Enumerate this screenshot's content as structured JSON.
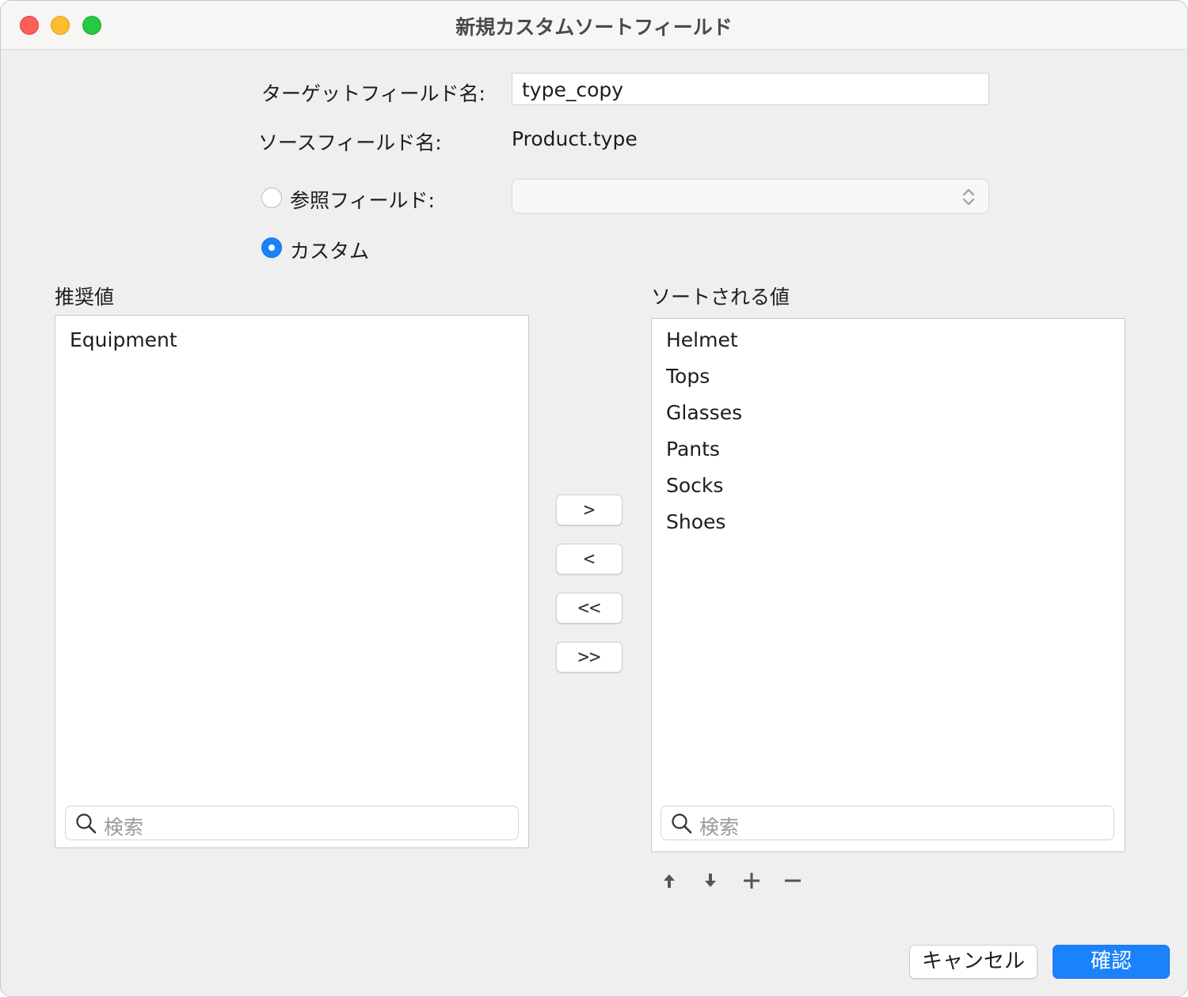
{
  "window": {
    "title": "新規カスタムソートフィールド"
  },
  "form": {
    "target_label": "ターゲットフィールド名:",
    "target_value": "type_copy",
    "source_label": "ソースフィールド名:",
    "source_value": "Product.type",
    "reference_label": "参照フィールド:",
    "reference_value": "",
    "custom_label": "カスタム",
    "selected_option": "custom"
  },
  "left_list": {
    "heading": "推奨値",
    "items": [
      "Equipment"
    ],
    "search_placeholder": "検索"
  },
  "right_list": {
    "heading": "ソートされる値",
    "items": [
      "Helmet",
      "Tops",
      "Glasses",
      "Pants",
      "Socks",
      "Shoes"
    ],
    "search_placeholder": "検索"
  },
  "move_buttons": {
    "add": ">",
    "remove": "<",
    "remove_all": "<<",
    "add_all": ">>"
  },
  "toolbar": {
    "icons": [
      "arrow-up-icon",
      "arrow-down-icon",
      "plus-icon",
      "minus-icon"
    ]
  },
  "footer": {
    "cancel_label": "キャンセル",
    "confirm_label": "確認"
  },
  "colors": {
    "accent": "#1a82fb",
    "traffic_red": "#fe5f57",
    "traffic_yellow": "#febc2e",
    "traffic_green": "#28c840"
  }
}
